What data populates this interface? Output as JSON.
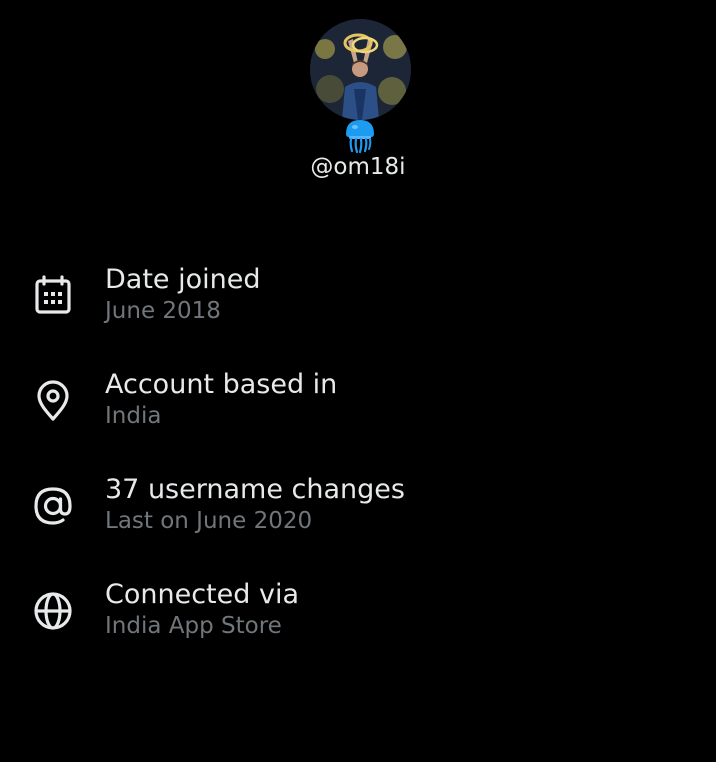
{
  "profile": {
    "handle": "@om18i"
  },
  "info": {
    "items": [
      {
        "icon": "calendar-icon",
        "title": "Date joined",
        "subtitle": "June 2018"
      },
      {
        "icon": "location-pin-icon",
        "title": "Account based in",
        "subtitle": "India"
      },
      {
        "icon": "at-sign-icon",
        "title": "37 username changes",
        "subtitle": "Last on June 2020"
      },
      {
        "icon": "globe-icon",
        "title": "Connected via",
        "subtitle": "India App Store"
      }
    ]
  },
  "colors": {
    "background": "#000000",
    "primary_text": "#e7e9ea",
    "secondary_text": "#71767b",
    "icon": "#e7e9ea",
    "badge": "#1d9bf0"
  }
}
